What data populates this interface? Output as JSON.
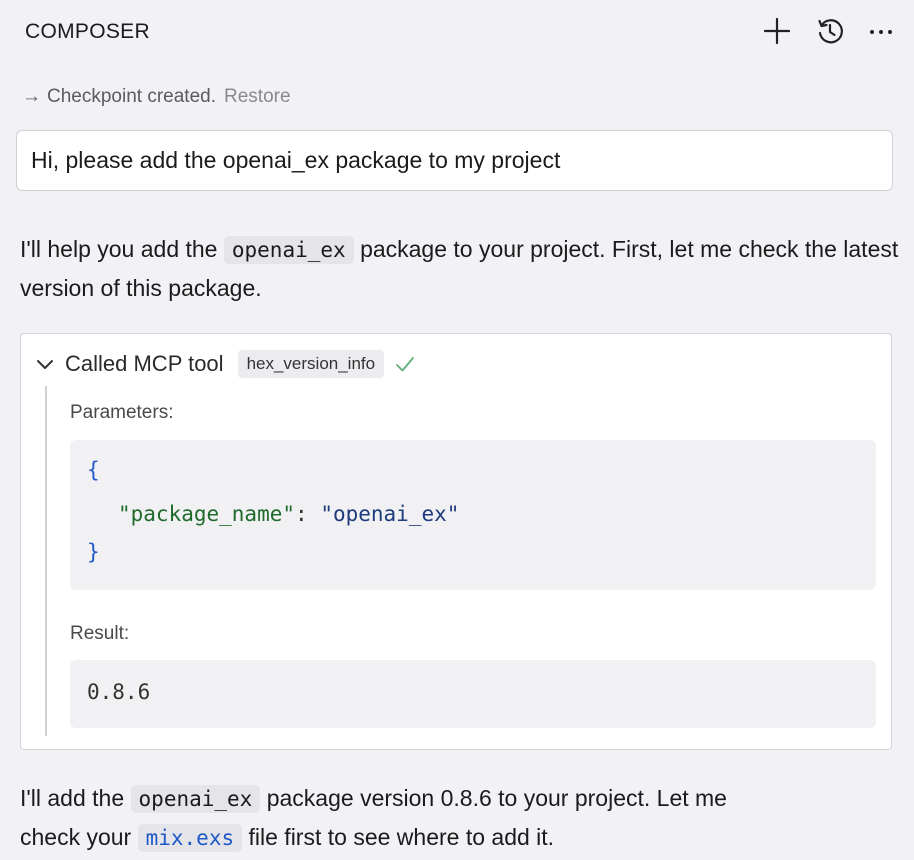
{
  "header": {
    "title": "COMPOSER",
    "icons": [
      "plus-icon",
      "history-icon",
      "more-icon"
    ]
  },
  "checkpoint": {
    "arrow": "→",
    "text": "Checkpoint created.",
    "restore": "Restore"
  },
  "user_message": "Hi, please add the openai_ex package to my project",
  "assistant_1": {
    "before": "I'll help you add the",
    "code": "openai_ex",
    "after": "package to your project. First, let me check the latest version of this package."
  },
  "tool_call": {
    "called_label": "Called MCP tool",
    "tool_name": "hex_version_info",
    "status": "success",
    "parameters_label": "Parameters:",
    "params": {
      "open_brace": "{",
      "key": "\"package_name\"",
      "colon": ":",
      "value": "\"openai_ex\"",
      "close_brace": "}"
    },
    "result_label": "Result:",
    "result": "0.8.6"
  },
  "assistant_2": {
    "p1": "I'll add the",
    "code1": "openai_ex",
    "p2": "package version 0.8.6 to your project. Let me",
    "p3": "check your",
    "code2": "mix.exs",
    "p4": "file first to see where to add it."
  },
  "colors": {
    "background": "#f2f2f6",
    "link": "#1f58c7",
    "success": "#5fb07a",
    "json_key": "#1f6a2b"
  }
}
